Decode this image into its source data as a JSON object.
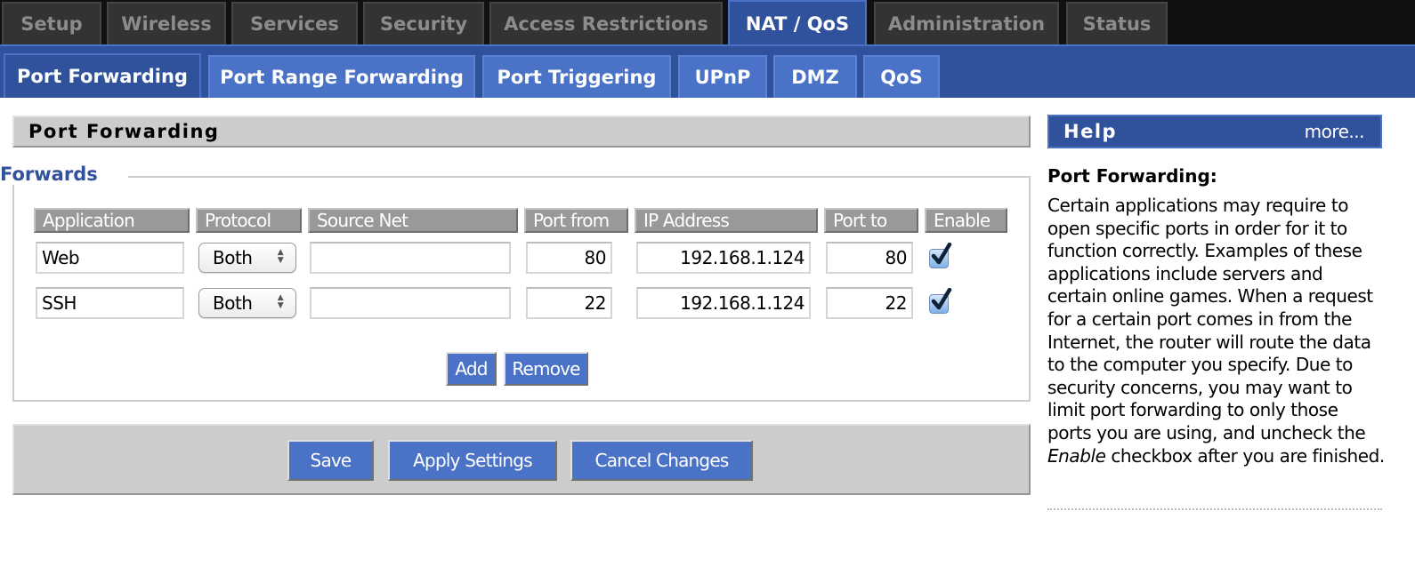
{
  "main_nav": {
    "tabs": [
      {
        "label": "Setup",
        "active": false
      },
      {
        "label": "Wireless",
        "active": false
      },
      {
        "label": "Services",
        "active": false
      },
      {
        "label": "Security",
        "active": false
      },
      {
        "label": "Access Restrictions",
        "active": false
      },
      {
        "label": "NAT / QoS",
        "active": true
      },
      {
        "label": "Administration",
        "active": false
      },
      {
        "label": "Status",
        "active": false
      }
    ]
  },
  "sub_nav": {
    "tabs": [
      {
        "label": "Port Forwarding",
        "active": true
      },
      {
        "label": "Port Range Forwarding",
        "active": false
      },
      {
        "label": "Port Triggering",
        "active": false
      },
      {
        "label": "UPnP",
        "active": false
      },
      {
        "label": "DMZ",
        "active": false
      },
      {
        "label": "QoS",
        "active": false
      }
    ]
  },
  "section": {
    "title": "Port Forwarding",
    "fieldset_legend": "Forwards"
  },
  "table": {
    "columns": [
      "Application",
      "Protocol",
      "Source Net",
      "Port from",
      "IP Address",
      "Port to",
      "Enable"
    ],
    "rows": [
      {
        "application": "Web",
        "protocol": "Both",
        "source_net": "",
        "port_from": "80",
        "ip_address": "192.168.1.124",
        "port_to": "80",
        "enabled": true
      },
      {
        "application": "SSH",
        "protocol": "Both",
        "source_net": "",
        "port_from": "22",
        "ip_address": "192.168.1.124",
        "port_to": "22",
        "enabled": true
      }
    ]
  },
  "row_actions": {
    "add_label": "Add",
    "remove_label": "Remove"
  },
  "footer_actions": {
    "save_label": "Save",
    "apply_label": "Apply Settings",
    "cancel_label": "Cancel Changes"
  },
  "help": {
    "title": "Help",
    "more_label": "more...",
    "heading": "Port Forwarding:",
    "body_before_em": "Certain applications may require to open specific ports in order for it to function correctly. Examples of these applications include servers and certain online games. When a request for a certain port comes in from the Internet, the router will route the data to the computer you specify. Due to security concerns, you may want to limit port forwarding to only those ports you are using, and uncheck the ",
    "body_em": "Enable",
    "body_after_em": " checkbox after you are finished."
  },
  "colors": {
    "accent_blue": "#30519b",
    "button_blue": "#4a72c6",
    "nav_dark": "#111111",
    "tab_dark": "#333333",
    "panel_gray": "#cccccc",
    "header_gray": "#999999"
  }
}
